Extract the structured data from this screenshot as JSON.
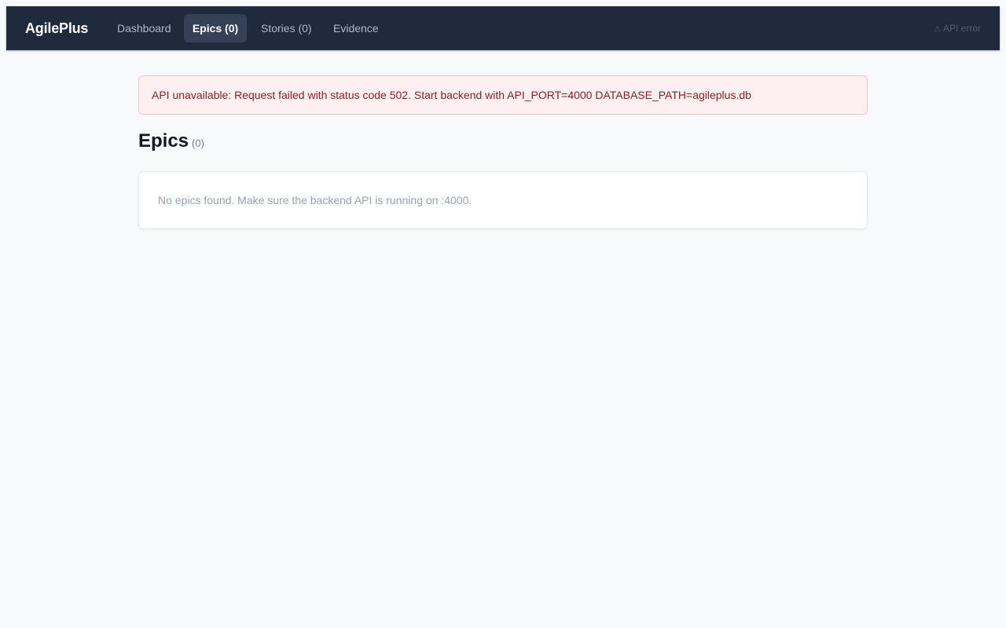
{
  "nav": {
    "brand": "AgilePlus",
    "links": [
      {
        "label": "Dashboard",
        "active": false
      },
      {
        "label": "Epics (0)",
        "active": true
      },
      {
        "label": "Stories (0)",
        "active": false
      },
      {
        "label": "Evidence",
        "active": false
      }
    ],
    "api_status": {
      "icon": "warning-icon",
      "glyph": "⚠",
      "label": "API error"
    }
  },
  "alert": {
    "message": "API unavailable: Request failed with status code 502. Start backend with API_PORT=4000 DATABASE_PATH=agileplus.db"
  },
  "page": {
    "title": "Epics",
    "count": "(0)"
  },
  "empty_state": {
    "message": "No epics found. Make sure the backend API is running on :4000."
  },
  "colors": {
    "nav_bg": "#1f2a3c",
    "nav_active_bg": "#344156",
    "page_bg": "#f8f9fb",
    "alert_bg": "#fef0f0",
    "alert_border": "#f6c6c6",
    "alert_text": "#8c1d1d"
  }
}
